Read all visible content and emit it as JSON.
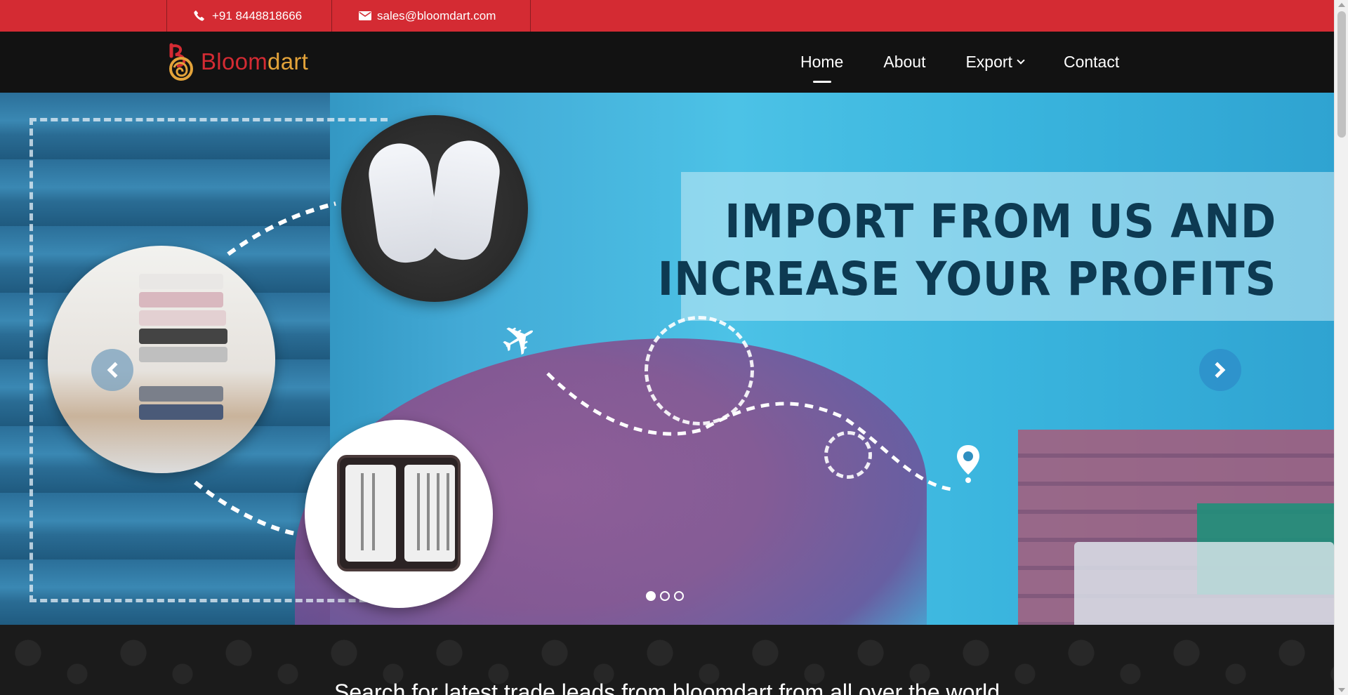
{
  "topbar": {
    "phone": {
      "icon": "phone-icon",
      "text": "+91 8448818666"
    },
    "email": {
      "icon": "mail-icon",
      "text": "sales@bloomdart.com"
    }
  },
  "header": {
    "logo": {
      "part1": "Bloom",
      "part2": "dart"
    },
    "nav": [
      {
        "label": "Home",
        "active": true
      },
      {
        "label": "About"
      },
      {
        "label": "Export",
        "has_dropdown": true
      },
      {
        "label": "Contact"
      }
    ]
  },
  "hero": {
    "headline_line1": "IMPORT FROM US AND",
    "headline_line2": "INCREASE YOUR PROFITS",
    "slides_total": 3,
    "active_slide": 1,
    "prev_icon": "chevron-left-icon",
    "next_icon": "chevron-right-icon"
  },
  "search_section": {
    "lead": "Search for latest trade leads from bloomdart from all over the world"
  },
  "colors": {
    "topbar": "#d42b33",
    "header": "#121212",
    "logo_red": "#d42b33",
    "logo_gold": "#e3a33a",
    "headline": "#0d3a52"
  }
}
